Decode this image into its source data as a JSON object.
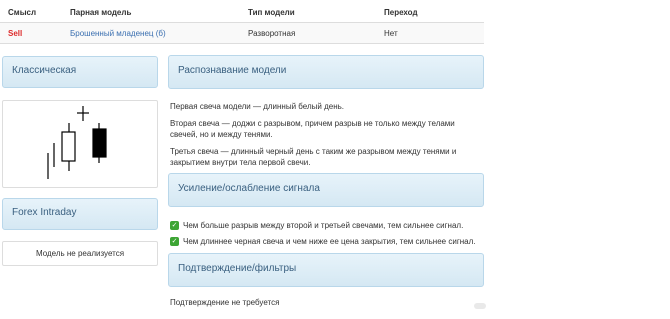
{
  "table": {
    "headers": [
      "Смысл",
      "Парная модель",
      "Тип модели",
      "Переход"
    ],
    "row": {
      "meaning": "Sell",
      "pair_model": "Брошенный младенец (б)",
      "model_type": "Разворотная",
      "transition": "Нет"
    }
  },
  "left": {
    "classic_title": "Классическая",
    "forex_title": "Forex Intraday",
    "forex_note": "Модель не реализуется"
  },
  "recognition": {
    "title": "Распознавание модели",
    "p1": "Первая свеча модели — длинный белый день.",
    "p2": "Вторая свеча — доджи с разрывом, причем разрыв не только между телами свечей, но и между тенями.",
    "p3": "Третья свеча — длинный черный день с таким же разрывом между тенями и закрытием внутри тела первой свечи."
  },
  "signal": {
    "title": "Усиление/ослабление сигнала",
    "items": [
      "Чем больше разрыв между второй и третьей свечами, тем сильнее сигнал.",
      "Чем длиннее черная свеча и чем ниже ее цена закрытия, тем сильнее сигнал."
    ]
  },
  "confirm": {
    "title": "Подтверждение/фильтры",
    "text": "Подтверждение не требуется"
  },
  "colors": {
    "sell": "#dd2b2b",
    "link": "#3a6fb0",
    "panel_header_bg": "#d5e8f3",
    "check": "#3da534"
  },
  "icons": [
    "check-icon",
    "candlestick-pattern-image"
  ]
}
